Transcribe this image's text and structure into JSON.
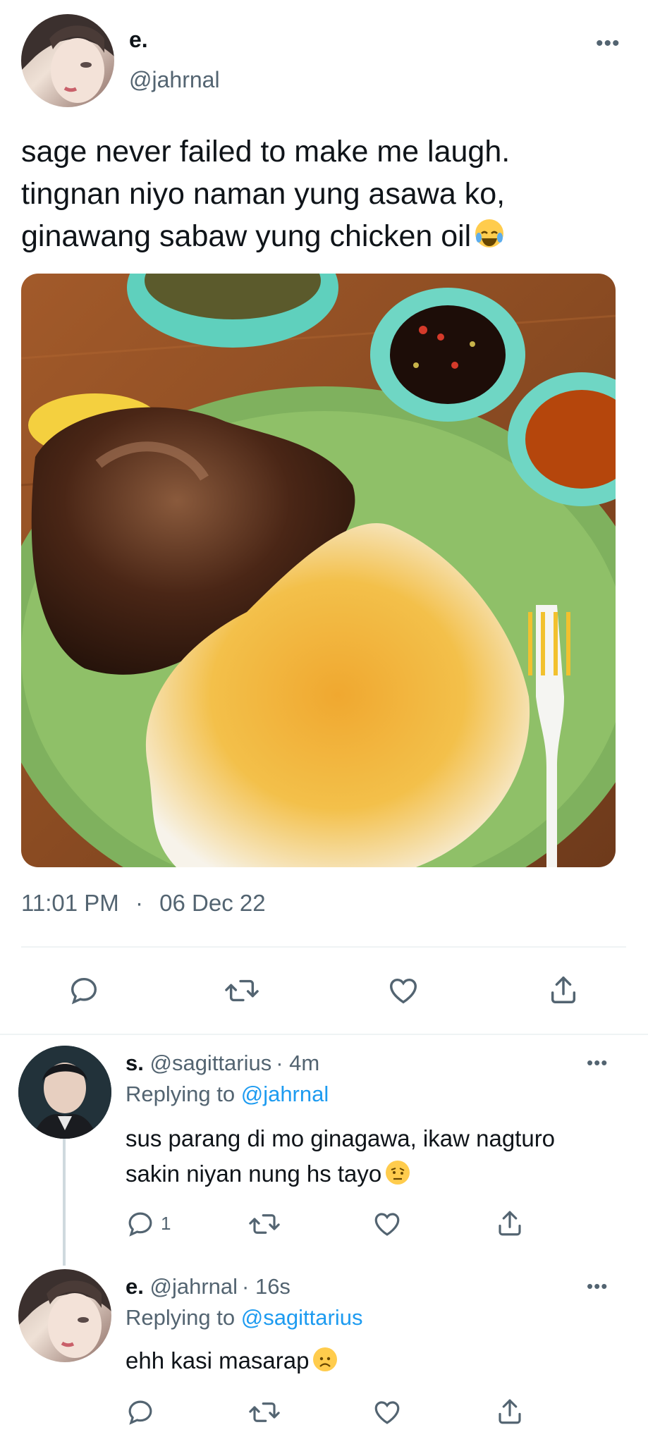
{
  "main_tweet": {
    "display_name": "e.",
    "handle": "@jahrnal",
    "text_lines": [
      "sage never failed to make me laugh.",
      "tingnan niyo naman yung asawa ko,",
      "ginawang sabaw yung chicken oil"
    ],
    "emoji": "joy-emoji",
    "time": "11:01 PM",
    "separator": "·",
    "date": "06 Dec 22",
    "actions": [
      "reply-icon",
      "retweet-icon",
      "like-icon",
      "share-icon"
    ]
  },
  "replies": [
    {
      "display_name": "s.",
      "handle": "@sagittarius",
      "time": "· 4m",
      "replying_prefix": "Replying to",
      "replying_to": "@jahrnal",
      "text_lines": [
        "sus parang di mo ginagawa, ikaw nagturo",
        "sakin niyan nung hs tayo"
      ],
      "emoji": "raised-eyebrow-emoji",
      "reply_count": "1"
    },
    {
      "display_name": "e.",
      "handle": "@jahrnal",
      "time": "· 16s",
      "replying_prefix": "Replying to",
      "replying_to": "@sagittarius",
      "text_lines": [
        "ehh kasi masarap"
      ],
      "emoji": "frowning-emoji"
    }
  ],
  "colors": {
    "accent": "#1d9bf0",
    "muted": "#536471",
    "divider": "#eff3f4",
    "plate": "#7fb15e",
    "bowl": "#6fd6c4",
    "table": "#8a4b22"
  }
}
